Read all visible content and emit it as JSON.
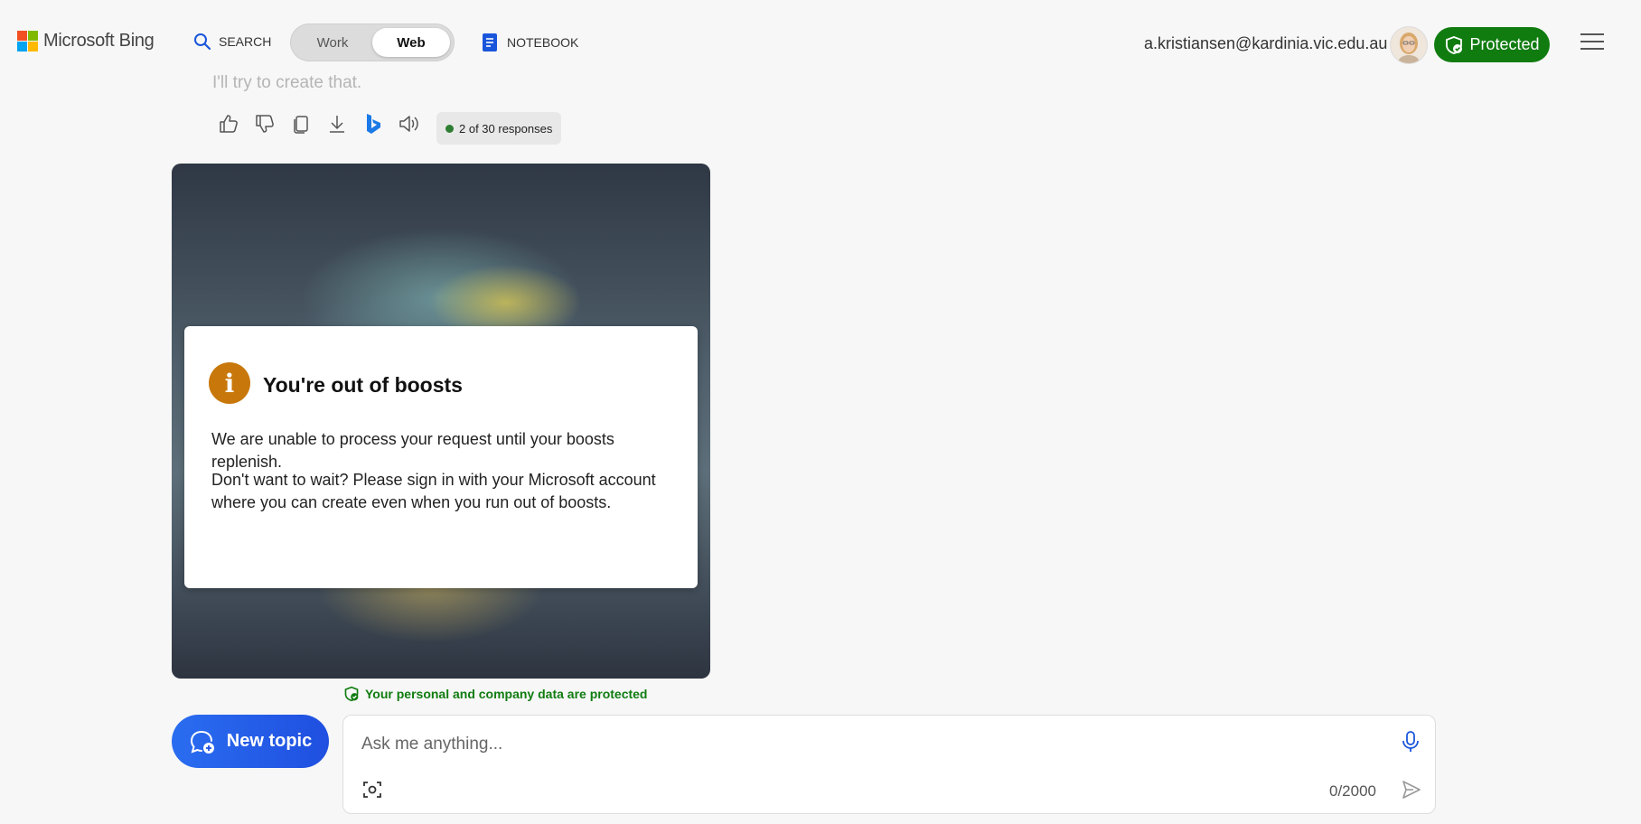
{
  "header": {
    "logo_text": "Microsoft Bing",
    "search_label": "SEARCH",
    "toggle": {
      "work_label": "Work",
      "web_label": "Web",
      "selected": "Web"
    },
    "notebook_label": "NOTEBOOK",
    "account_email": "a.kristiansen@kardinia.vic.edu.au",
    "protected_label": "Protected"
  },
  "conversation": {
    "faded_text": "I'll try to create that.",
    "actions": [
      "thumbs-up-icon",
      "thumbs-down-icon",
      "copy-icon",
      "download-icon",
      "bing-icon",
      "speaker-icon"
    ],
    "response_count": "2 of 30 responses"
  },
  "dialog": {
    "title": "You're out of boosts",
    "paragraph1": "We are unable to process your request until your boosts replenish.",
    "paragraph2": "Don't want to wait? Please sign in with your Microsoft account where you can create even when you run out of boosts."
  },
  "footer": {
    "privacy_note": "Your personal and company data are protected",
    "new_topic_label": "New topic",
    "input_placeholder": "Ask me anything...",
    "char_count": "0/2000"
  },
  "colors": {
    "protected_green": "#107c10",
    "accent_blue": "#2a6df0",
    "warning_orange": "#c8780a"
  }
}
